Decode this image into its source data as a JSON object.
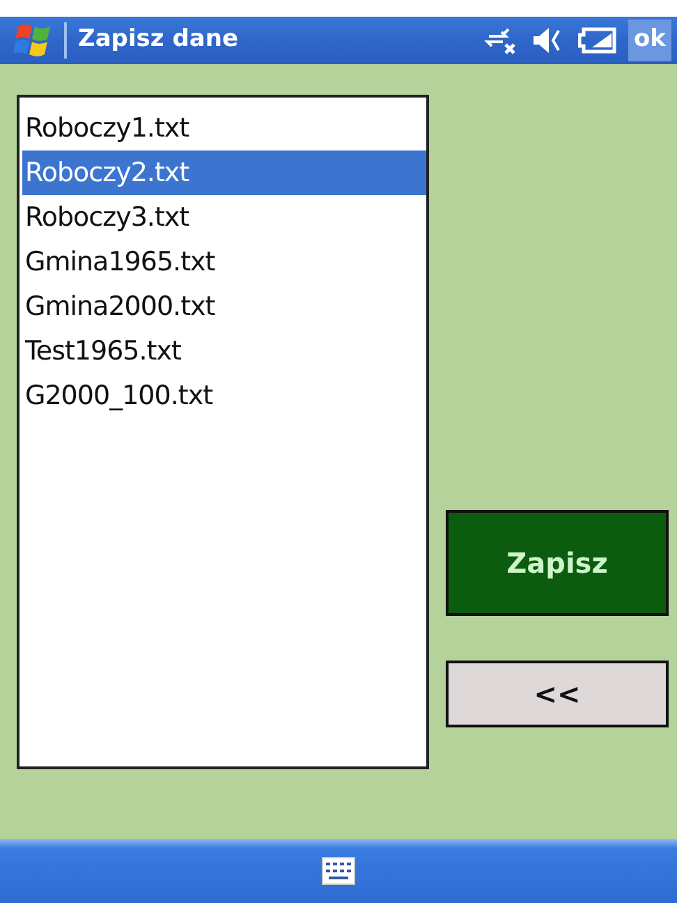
{
  "title_bar": {
    "title": "Zapisz dane",
    "ok": "ok"
  },
  "files": [
    {
      "name": "Roboczy1.txt",
      "selected": false
    },
    {
      "name": "Roboczy2.txt",
      "selected": true
    },
    {
      "name": "Roboczy3.txt",
      "selected": false
    },
    {
      "name": "Gmina1965.txt",
      "selected": false
    },
    {
      "name": "Gmina2000.txt",
      "selected": false
    },
    {
      "name": "Test1965.txt",
      "selected": false
    },
    {
      "name": "G2000_100.txt",
      "selected": false
    }
  ],
  "buttons": [
    {
      "kind": "primary",
      "label": "Zapisz"
    },
    {
      "kind": "secondary",
      "label": "<<"
    }
  ]
}
